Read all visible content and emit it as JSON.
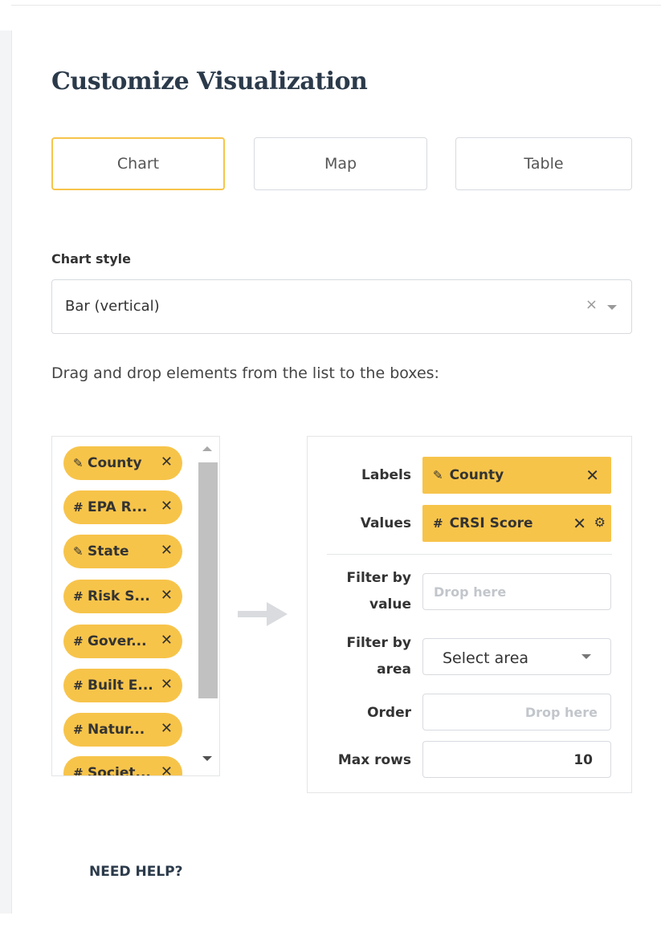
{
  "title": "Customize Visualization",
  "tabs": {
    "chart": "Chart",
    "map": "Map",
    "table": "Table",
    "active": "Chart"
  },
  "chart_style": {
    "label": "Chart style",
    "value": "Bar (vertical)",
    "clear": "×"
  },
  "instructions": "Drag and drop elements from the list to the boxes:",
  "fields": [
    {
      "glyph": "✎",
      "label": "County"
    },
    {
      "glyph": "#",
      "label": "EPA R..."
    },
    {
      "glyph": "✎",
      "label": "State"
    },
    {
      "glyph": "#",
      "label": "Risk S..."
    },
    {
      "glyph": "#",
      "label": "Gover..."
    },
    {
      "glyph": "#",
      "label": "Built E..."
    },
    {
      "glyph": "#",
      "label": "Natur..."
    },
    {
      "glyph": "#",
      "label": "Societ..."
    }
  ],
  "remove_glyph": "✕",
  "drop_zone": {
    "labels": {
      "label": "Labels",
      "glyph": "✎",
      "value": "County"
    },
    "values": {
      "label": "Values",
      "glyph": "#",
      "value": "CRSI Score",
      "gear": "⚙"
    },
    "filter_value": {
      "label_line1": "Filter by",
      "label_line2": "value",
      "placeholder": "Drop here"
    },
    "filter_area": {
      "label_line1": "Filter by",
      "label_line2": "area",
      "value": "Select area"
    },
    "order": {
      "label": "Order",
      "placeholder": "Drop here"
    },
    "max_rows": {
      "label": "Max rows",
      "value": "10"
    }
  },
  "help": "NEED HELP?",
  "colors": {
    "accent": "#f7c44a",
    "border": "#d7dadf",
    "title": "#2b3a4a"
  }
}
